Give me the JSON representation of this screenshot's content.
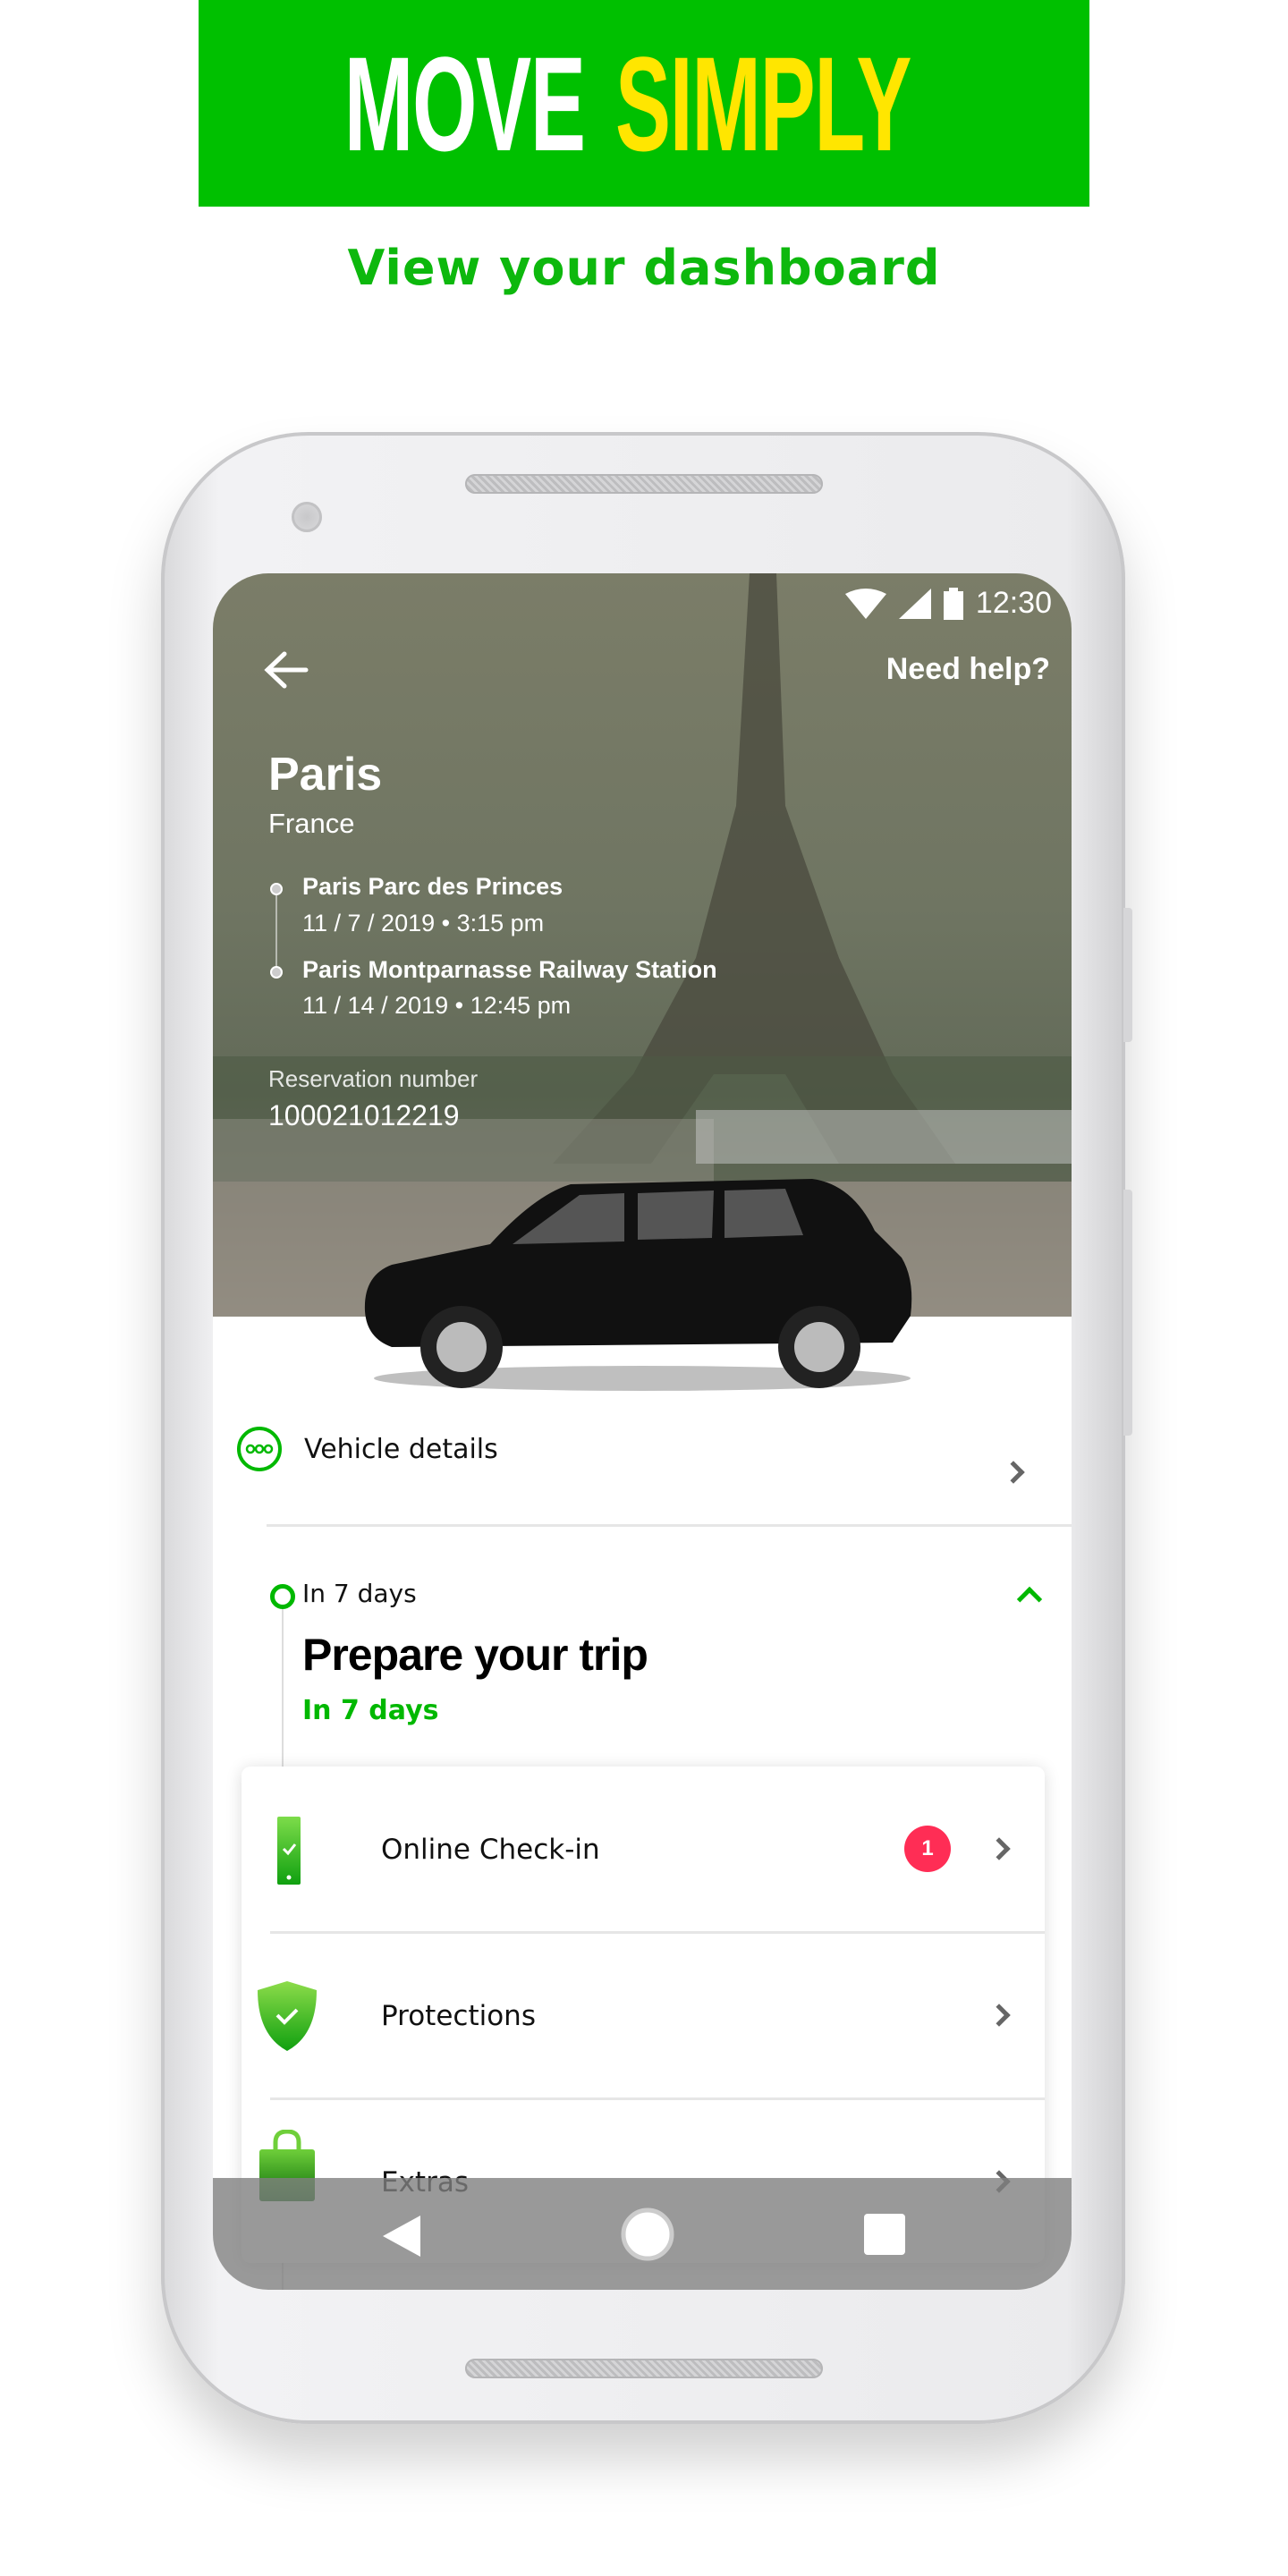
{
  "promo": {
    "headline_word1": "MOVE",
    "headline_word2": "SIMPLY",
    "subtitle": "View your dashboard",
    "colors": {
      "brand_green": "#00c000",
      "accent_yellow": "#ffe600"
    }
  },
  "status_bar": {
    "time": "12:30",
    "icons": [
      "wifi-icon",
      "signal-icon",
      "battery-icon"
    ]
  },
  "header": {
    "back_icon": "arrow-left-icon",
    "help_label": "Need help?"
  },
  "trip": {
    "city": "Paris",
    "country": "France",
    "stops": [
      {
        "name": "Paris Parc des Princes",
        "datetime": "11 / 7 / 2019 • 3:15 pm"
      },
      {
        "name": "Paris Montparnasse Railway Station",
        "datetime": "11 / 14 / 2019 • 12:45 pm"
      }
    ],
    "reservation_label": "Reservation number",
    "reservation_number": "100021012219"
  },
  "vehicle_details": {
    "label": "Vehicle details",
    "icon": "more-dots-icon"
  },
  "timeline": {
    "overline": "In 7 days",
    "title": "Prepare your trip",
    "subtitle": "In 7 days",
    "expanded": true
  },
  "tasks": [
    {
      "label": "Online Check-in",
      "icon": "phone-check-icon",
      "badge": "1"
    },
    {
      "label": "Protections",
      "icon": "shield-check-icon"
    },
    {
      "label": "Extras",
      "icon": "shopping-bag-icon"
    }
  ],
  "nav_bar": {
    "buttons": [
      "back",
      "home",
      "recents"
    ]
  },
  "colors": {
    "green": "#00b800",
    "badge": "#ff2d55"
  }
}
